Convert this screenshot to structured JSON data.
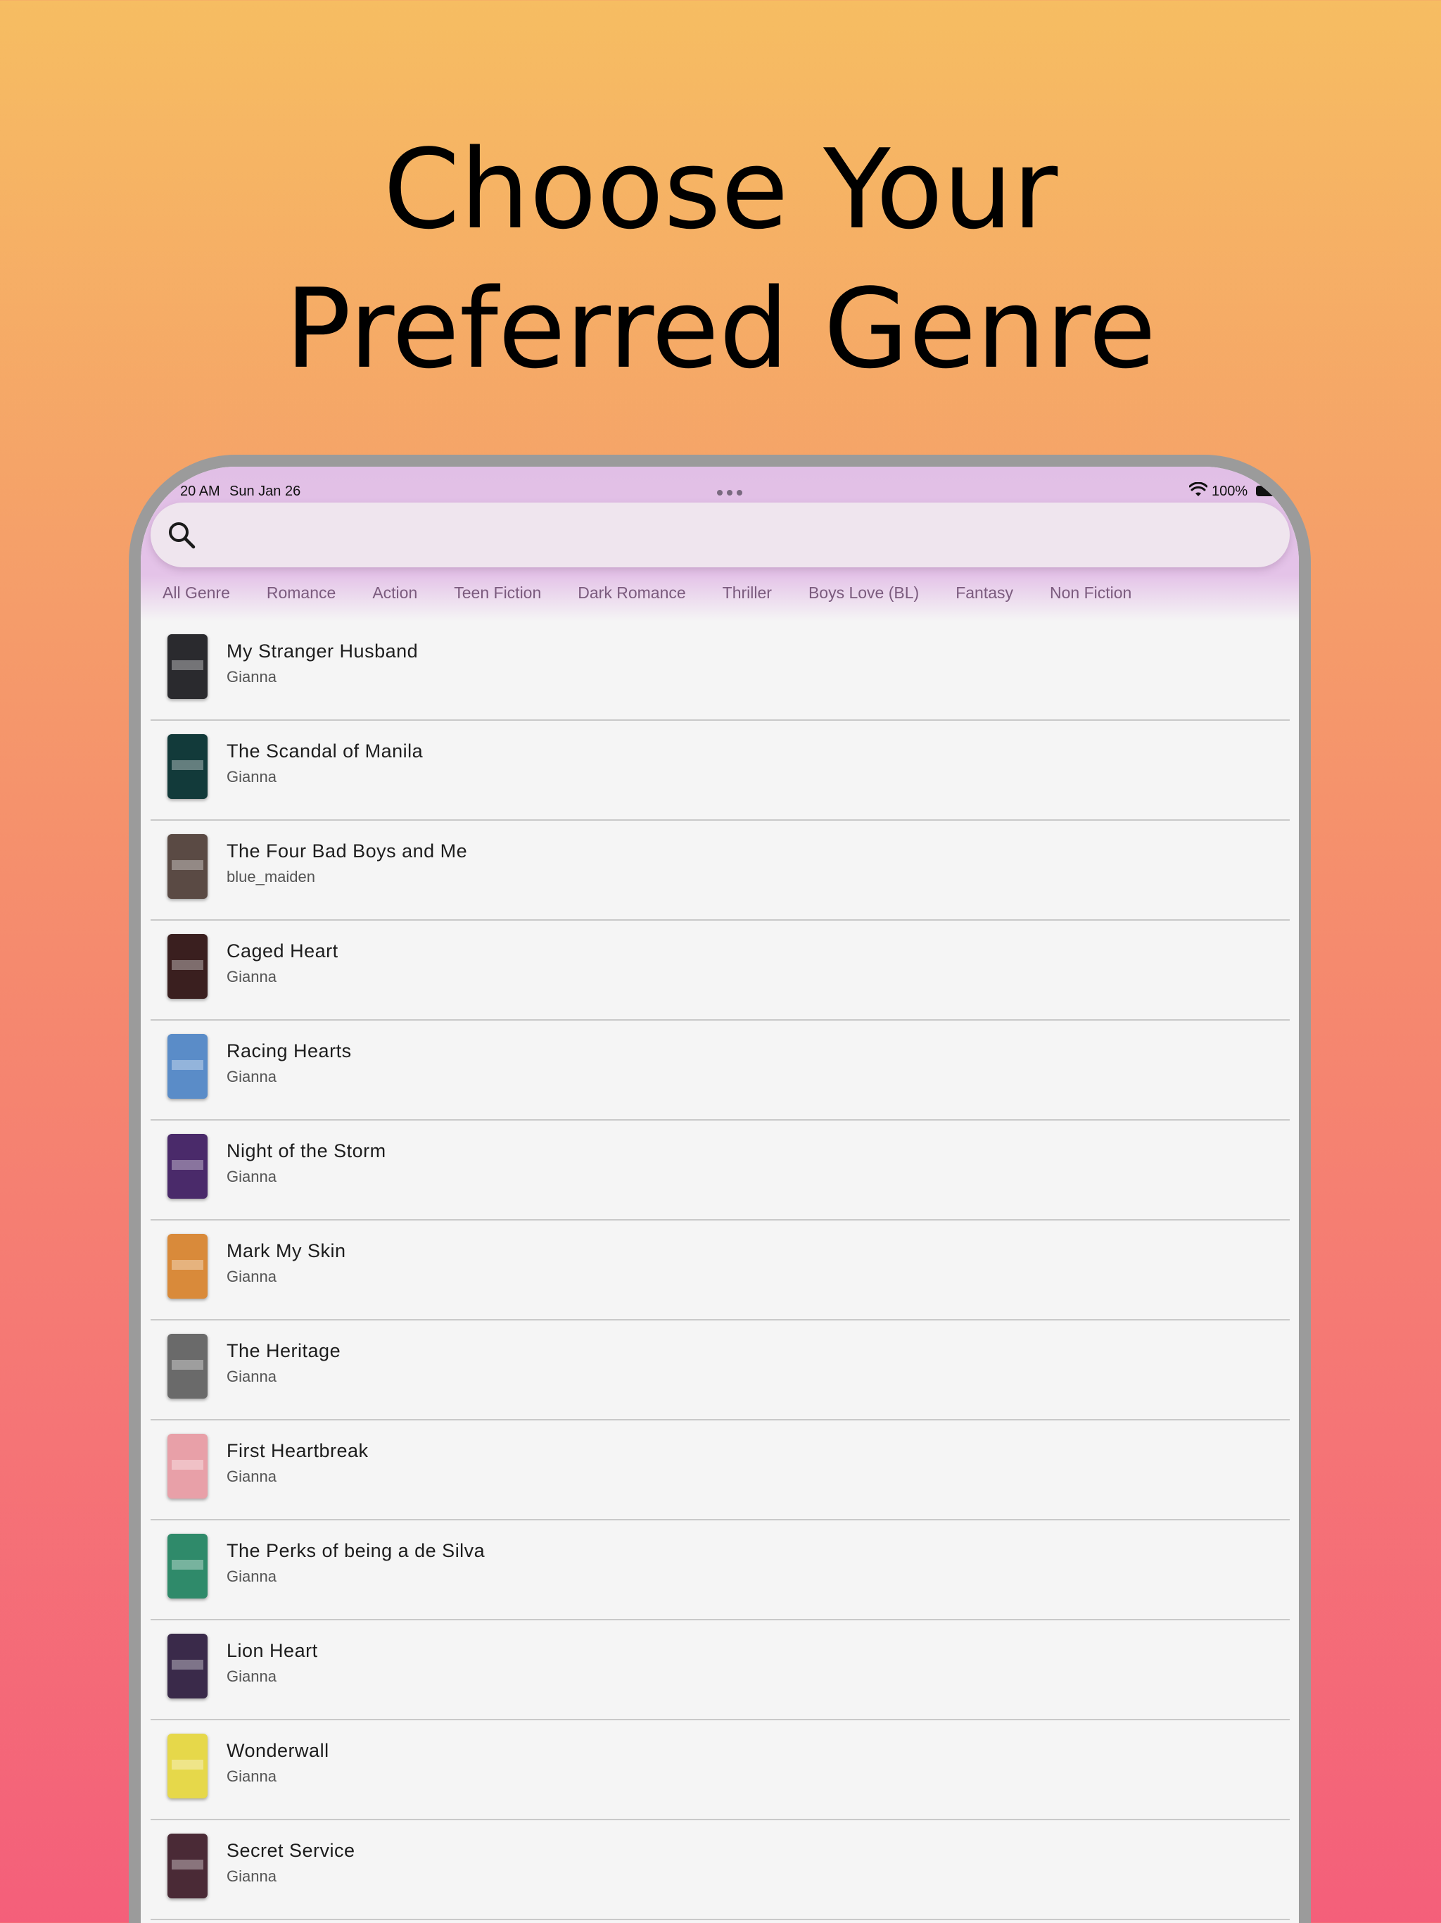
{
  "headline": {
    "line1": "Choose Your",
    "line2": "Preferred Genre"
  },
  "status": {
    "time": "20 AM",
    "date": "Sun Jan 26",
    "battery": "100%"
  },
  "search": {
    "placeholder": ""
  },
  "genres": [
    "All Genre",
    "Romance",
    "Action",
    "Teen Fiction",
    "Dark Romance",
    "Thriller",
    "Boys Love (BL)",
    "Fantasy",
    "Non Fiction"
  ],
  "books": [
    {
      "title": "My Stranger Husband",
      "author": "Gianna",
      "cover_color": "#2a2a2e"
    },
    {
      "title": "The Scandal of Manila",
      "author": "Gianna",
      "cover_color": "#123a3a"
    },
    {
      "title": "The Four Bad Boys and Me",
      "author": "blue_maiden",
      "cover_color": "#5a4a44"
    },
    {
      "title": "Caged Heart",
      "author": "Gianna",
      "cover_color": "#3a1f1f"
    },
    {
      "title": "Racing Hearts",
      "author": "Gianna",
      "cover_color": "#5a8cc8"
    },
    {
      "title": "Night of the Storm",
      "author": "Gianna",
      "cover_color": "#4a2a6a"
    },
    {
      "title": "Mark My Skin",
      "author": "Gianna",
      "cover_color": "#d98a3a"
    },
    {
      "title": "The Heritage",
      "author": "Gianna",
      "cover_color": "#6a6a6a"
    },
    {
      "title": "First Heartbreak",
      "author": "Gianna",
      "cover_color": "#e8a0a8"
    },
    {
      "title": "The Perks of being a de Silva",
      "author": "Gianna",
      "cover_color": "#2f8a6a"
    },
    {
      "title": "Lion Heart",
      "author": "Gianna",
      "cover_color": "#3a2a4a"
    },
    {
      "title": "Wonderwall",
      "author": "Gianna",
      "cover_color": "#e6d84a"
    },
    {
      "title": "Secret Service",
      "author": "Gianna",
      "cover_color": "#4a2a36"
    }
  ]
}
